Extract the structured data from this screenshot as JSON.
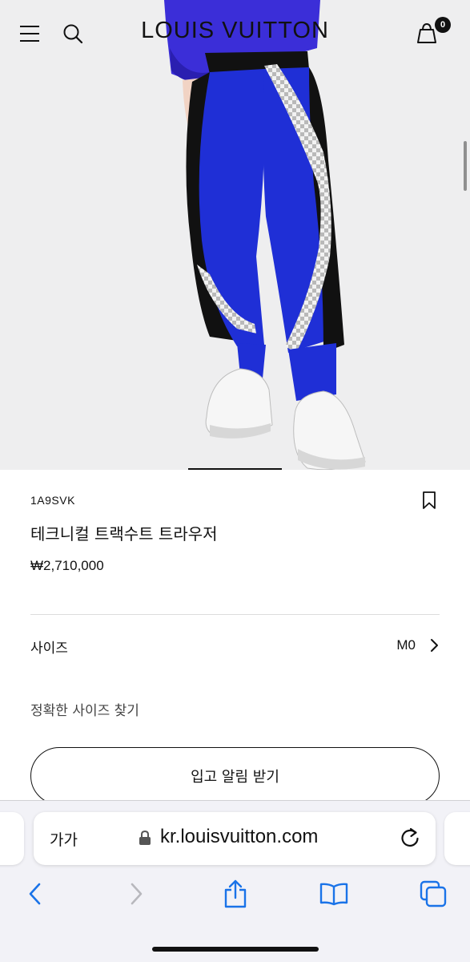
{
  "header": {
    "logo_text": "LOUIS VUITTON",
    "bag_count": "0",
    "menu_icon": "hamburger-menu-icon",
    "search_icon": "search-icon",
    "bag_icon": "shopping-bag-icon"
  },
  "hero": {
    "image_subject": "model wearing blue and black technical tracksuit trousers with white sneakers",
    "carousel_active_index": 2
  },
  "product": {
    "sku": "1A9SVK",
    "title": "테크니컬 트랙수트 트라우저",
    "price": "₩2,710,000",
    "bookmark_icon": "bookmark-icon"
  },
  "size": {
    "label": "사이즈",
    "value": "M0",
    "chevron_icon": "chevron-right-icon"
  },
  "size_guide_link": "정확한 사이즈 찾기",
  "notify_button": "입고 알림 받기",
  "browser": {
    "text_size_label": "가가",
    "url": "kr.louisvuitton.com",
    "lock_icon": "lock-icon",
    "reload_icon": "reload-icon",
    "toolbar_icons": [
      "back-icon",
      "forward-icon",
      "share-icon",
      "bookmarks-icon",
      "tabs-icon"
    ],
    "accent": "#1a73e8"
  },
  "colors": {
    "trouser_blue": "#1f2fd6",
    "trouser_black": "#111111",
    "background": "#eeeeef"
  }
}
